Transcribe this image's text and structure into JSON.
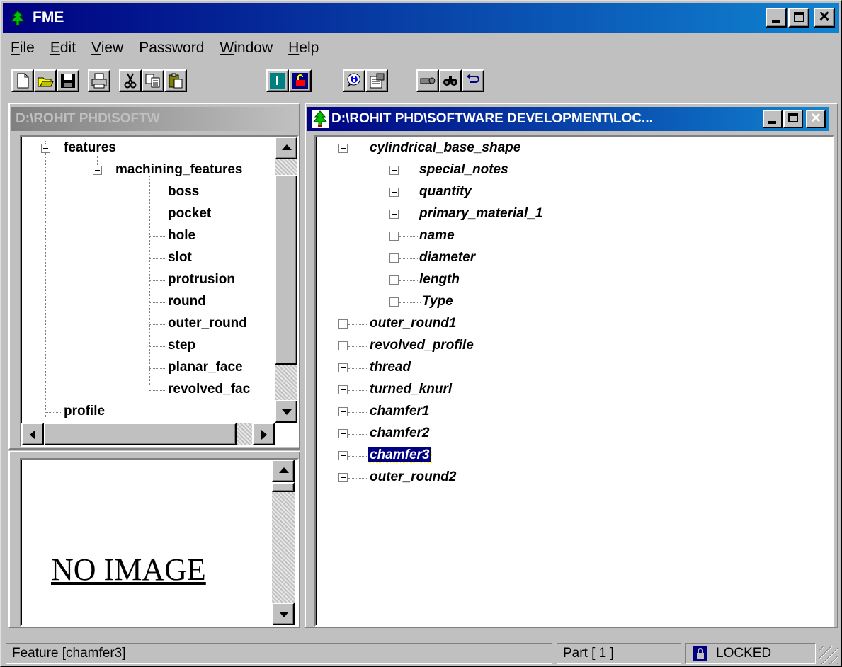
{
  "app": {
    "title": "FME"
  },
  "menu": [
    {
      "underline": "F",
      "rest": "ile"
    },
    {
      "underline": "E",
      "rest": "dit"
    },
    {
      "underline": "V",
      "rest": "iew"
    },
    {
      "underline": "",
      "rest": "Password"
    },
    {
      "underline": "W",
      "rest": "indow"
    },
    {
      "underline": "H",
      "rest": "elp"
    }
  ],
  "toolbar": [
    "new-icon",
    "open-icon",
    "save-icon",
    "print-icon",
    "cut-icon",
    "copy-icon",
    "paste-icon",
    "info-panel-icon",
    "lock-icon",
    "about-icon",
    "properties-icon",
    "key-icon",
    "find-icon",
    "undo-icon"
  ],
  "left_panel": {
    "title": "D:\\ROHIT PHD\\SOFTW",
    "tree": {
      "root": "features",
      "child": "machining_features",
      "items": [
        "boss",
        "pocket",
        "hole",
        "slot",
        "protrusion",
        "round",
        "outer_round",
        "step",
        "planar_face",
        "revolved_fac"
      ],
      "sibling": "profile"
    },
    "preview_text": "NO IMAGE"
  },
  "main_window": {
    "title": "D:\\ROHIT PHD\\SOFTWARE DEVELOPMENT\\LOC...",
    "tree": {
      "root": "cylindrical_base_shape",
      "root_children": [
        "special_notes",
        "quantity",
        "primary_material_1",
        "name",
        "diameter",
        "length",
        "Type"
      ],
      "siblings": [
        "outer_round1",
        "revolved_profile",
        "thread",
        "turned_knurl",
        "chamfer1",
        "chamfer2",
        "chamfer3",
        "outer_round2"
      ],
      "selected": "chamfer3"
    }
  },
  "status": {
    "feature": "Feature [chamfer3]",
    "part": "Part [ 1 ]",
    "lock": "LOCKED"
  },
  "colors": {
    "titlebar": "#000080",
    "face": "#c0c0c0",
    "selection": "#000080"
  }
}
